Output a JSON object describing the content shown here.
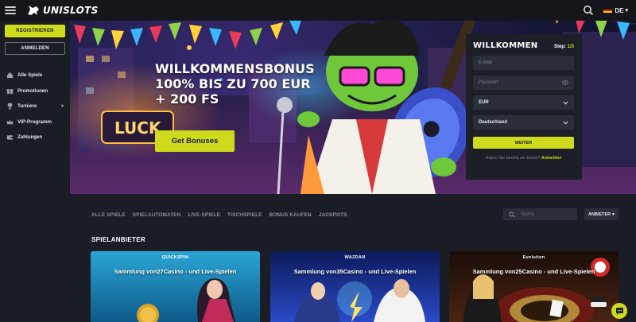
{
  "header": {
    "logo_text": "UNISLOTS",
    "language": "DE"
  },
  "sidebar": {
    "register_label": "REGISTRIEREN",
    "login_label": "ANMELDEN",
    "items": [
      {
        "label": "Alle Spiele",
        "icon": "home-icon"
      },
      {
        "label": "Promotionen",
        "icon": "gift-icon"
      },
      {
        "label": "Turniere",
        "icon": "trophy-icon"
      },
      {
        "label": "VIP-Programm",
        "icon": "crown-icon"
      },
      {
        "label": "Zahlungen",
        "icon": "wallet-icon"
      }
    ]
  },
  "hero": {
    "title_lines": [
      "WILLKOMMENSBONUS",
      "100% BIS ZU 700 EUR",
      "+ 200 FS"
    ],
    "cta_label": "Get Bonuses",
    "signage": "LUCK"
  },
  "welcome": {
    "title": "WILLKOMMEN",
    "step_label": "Step:",
    "step_value": "1/3",
    "email_placeholder": "E-Mail",
    "password_placeholder": "Passwort",
    "currency": "EUR",
    "country": "Deutschland",
    "next_label": "WEITER",
    "have_account": "Haben Sie bereits ein Konto?",
    "login_link": "Anmelden"
  },
  "games": {
    "filters": [
      "ALLE SPIELE",
      "SPIELAUTOMATEN",
      "LIVE-SPIELE",
      "TISCHSPIELE",
      "BONUS KAUFEN",
      "JACKPOTS"
    ],
    "search_placeholder": "Suche",
    "provider_button": "ANBIETER"
  },
  "providers": {
    "title": "SPIELANBIETER",
    "cards": [
      {
        "brand": "QUICKSPIN",
        "title": "Sammlung von27Casino - und Live-Spielen",
        "color": "#1e8fb8"
      },
      {
        "brand": "WAZDAN",
        "title": "Sammlung von35Casino - und Live-Spielen",
        "color": "#1a3fa0"
      },
      {
        "brand": "Evolution",
        "title": "Sammlung von25Casino - und Live-Spielen",
        "color": "#3a1a10"
      }
    ]
  },
  "colors": {
    "accent": "#cddb1c",
    "panel": "#1c1f27",
    "background": "#1a1d25"
  }
}
